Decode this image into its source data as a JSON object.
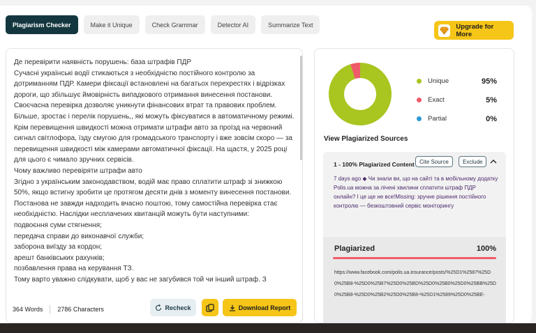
{
  "tabs": [
    {
      "label": "Plagiarism Checker",
      "active": true
    },
    {
      "label": "Make it Unique",
      "active": false
    },
    {
      "label": "Check Grammar",
      "active": false
    },
    {
      "label": "Detector AI",
      "active": false
    },
    {
      "label": "Summarize Text",
      "active": false
    }
  ],
  "upgrade": {
    "label": "Upgrade for More"
  },
  "editor": {
    "lines": [
      "Де перевірити наявність порушень: база штрафів ПДР",
      "Сучасні українські водії стикаються з необхідністю постійного контролю за дотриманням ПДР. Камери фіксації встановлені на багатьох перехрестях і відрізках дороги, що збільшує ймовірність випадкового отримання винесення постанови. Своєчасна перевірка дозволяє уникнути фінансових втрат та правових проблем. Більше, зростає і перелік порушень,, які можуть фіксуватися в автоматичному режимі.",
      "Крім перевищення швидкості можна отримати штрафи авто за проїзд на червоний сигнал світлофора, їзду смугою для громадського транспорту і вже зовсім скоро — за перевищення швидкості між камерами автоматичної фіксації. На щастя, у 2025 році для цього є чимало зручних сервісів.",
      "Чому важливо перевіряти штрафи авто",
      "Згідно з українським законодавством, водій має право сплатити штраф зі знижкою 50%, якщо встигну зробити це протягом десяти днів з моменту винесення постанови. Постанова не завжди надходить вчасно поштою, тому самостійна перевірка стає необхідністю. Наслідки несплачених квитанцій можуть бути наступними:",
      "подвоєння суми стягнення;",
      "передача справи до виконавчої служби;",
      "заборона виїзду за кордон;",
      "арешт банківських рахунків;",
      "позбавлення права на керування ТЗ.",
      "Тому варто уважно слідкувати, щоб у вас не загубився той чи інший штраф. З"
    ]
  },
  "footer": {
    "words": "364 Words",
    "characters": "2786 Characters",
    "recheck": "Recheck",
    "download": "Download Report"
  },
  "results": {
    "legend": [
      {
        "label": "Unique",
        "value": "95%",
        "color": "#a8c520"
      },
      {
        "label": "Exact",
        "value": "5%",
        "color": "#ef5b68"
      },
      {
        "label": "Partial",
        "value": "0%",
        "color": "#2e9bd6"
      }
    ],
    "unique_fraction": 0.95,
    "exact_fraction": 0.05,
    "view_title": "View Plagiarized Sources",
    "source": {
      "heading": "1 - 100% Plagiarized Content",
      "cite": "Cite Source",
      "exclude": "Exclude",
      "snippet": "7 days ago ◆ Чи знали ви, що на сайті та в мобільному додатку Polis.ua можна за лічені хвилини сплатити штраф ПДР онлайн? І це ще не все!Missing: зручне рішення постійного контролю — безкоштовний сервіс моніторингу",
      "plagiarized_label": "Plagiarized",
      "plagiarized_value": "100%",
      "url": "https://www.facebook.com/polis.ua.insurance/posts/%25D1%2587%25D0%25B8-%25D0%25B7%25D0%25BD%25D0%25B0%25D0%25BB%25D0%25B8-%25D0%25B2%25D0%25B8-%25D1%2589%25D0%25BE-"
    }
  }
}
